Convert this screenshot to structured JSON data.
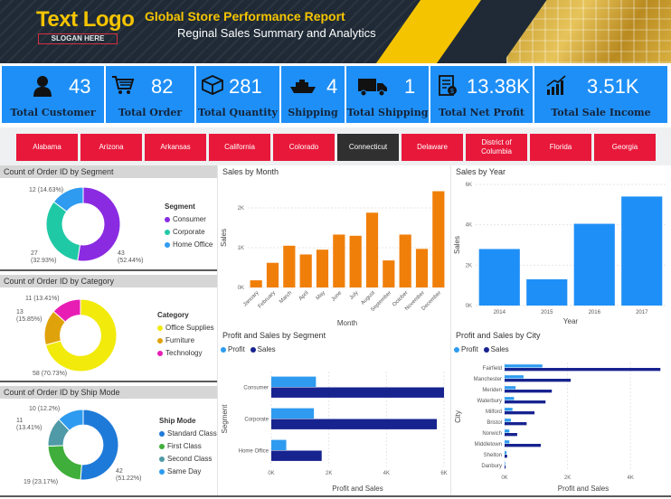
{
  "header": {
    "logo_text": "Text Logo",
    "logo_slogan": "SLOGAN HERE",
    "title": "Global Store Performance Report",
    "subtitle": "Reginal Sales Summary and Analytics"
  },
  "kpis": [
    {
      "value": "43",
      "label": "Total Customer",
      "icon": "person-icon"
    },
    {
      "value": "82",
      "label": "Total Order",
      "icon": "cart-icon"
    },
    {
      "value": "281",
      "label": "Total Quantity",
      "icon": "box-icon"
    },
    {
      "value": "4",
      "label": "Shipping",
      "icon": "ship-icon"
    },
    {
      "value": "1",
      "label": "Total Shipping",
      "icon": "truck-icon"
    },
    {
      "value": "13.38K",
      "label": "Total Net Profit",
      "icon": "invoice-icon"
    },
    {
      "value": "3.51K",
      "label": "Total Sale Income",
      "icon": "growth-chart-icon"
    }
  ],
  "states": [
    {
      "label": "Alabama",
      "active": false
    },
    {
      "label": "Arizona",
      "active": false
    },
    {
      "label": "Arkansas",
      "active": false
    },
    {
      "label": "California",
      "active": false
    },
    {
      "label": "Colorado",
      "active": false
    },
    {
      "label": "Connecticut",
      "active": true
    },
    {
      "label": "Delaware",
      "active": false
    },
    {
      "label": "District of Columbia",
      "active": false
    },
    {
      "label": "Florida",
      "active": false
    },
    {
      "label": "Georgia",
      "active": false
    }
  ],
  "colors": {
    "kpi_blue": "#1e8ff7",
    "state_red": "#e8183a",
    "state_active": "#303030",
    "orange": "#f07f0a",
    "bar_blue": "#1e8ff7",
    "profit": "#2e9bf0",
    "sales": "#17238f"
  },
  "panels": {
    "segment": {
      "title": "Count of Order ID by Segment",
      "legend_title": "Segment",
      "labels": [
        {
          "text": "12 (14.63%)"
        },
        {
          "text": "27 (32.93%)"
        },
        {
          "text": "43 (52.44%)"
        }
      ]
    },
    "category": {
      "title": "Count of Order ID by Category",
      "legend_title": "Category",
      "labels": [
        {
          "text": "11 (13.41%)"
        },
        {
          "text": "13 (15.85%)"
        },
        {
          "text": "58 (70.73%)"
        }
      ]
    },
    "shipmode": {
      "title": "Count of Order ID by Ship Mode",
      "legend_title": "Ship Mode",
      "labels": [
        {
          "text": "10 (12.2%)"
        },
        {
          "text": "11 (13.41%)"
        },
        {
          "text": "19 (23.17%)"
        },
        {
          "text": "42 (51.22%)"
        }
      ]
    },
    "month": {
      "title": "Sales by Month"
    },
    "year": {
      "title": "Sales by Year"
    },
    "profit_segment": {
      "title": "Profit and Sales by Segment"
    },
    "profit_city": {
      "title": "Profit and Sales by City"
    }
  },
  "chart_data": [
    {
      "type": "pie",
      "title": "Count of Order ID by Segment",
      "categories": [
        "Consumer",
        "Corporate",
        "Home Office"
      ],
      "values": [
        43,
        27,
        12
      ],
      "colors": [
        "#8a2be2",
        "#20c9a6",
        "#2e9bf0"
      ],
      "legend": "right"
    },
    {
      "type": "pie",
      "title": "Count of Order ID by Category",
      "categories": [
        "Office Supplies",
        "Furniture",
        "Technology"
      ],
      "values": [
        58,
        13,
        11
      ],
      "colors": [
        "#f2ea0a",
        "#e0a20a",
        "#e81eb4"
      ],
      "legend": "right"
    },
    {
      "type": "pie",
      "title": "Count of Order ID by Ship Mode",
      "categories": [
        "Standard Class",
        "First Class",
        "Second Class",
        "Same Day"
      ],
      "values": [
        42,
        19,
        11,
        10
      ],
      "colors": [
        "#1e7ad8",
        "#3fae3a",
        "#4f9aa6",
        "#2e9bf0"
      ],
      "legend": "right"
    },
    {
      "type": "bar",
      "title": "Sales by Month",
      "xlabel": "Month",
      "ylabel": "Sales",
      "categories": [
        "January",
        "February",
        "March",
        "April",
        "May",
        "June",
        "July",
        "August",
        "September",
        "October",
        "November",
        "December"
      ],
      "values": [
        180,
        620,
        1050,
        830,
        950,
        1330,
        1300,
        1880,
        680,
        1330,
        970,
        2420
      ],
      "ylim": [
        0,
        2500
      ],
      "yticks": [
        "0K",
        "1K",
        "2K"
      ],
      "ytick_values": [
        0,
        1000,
        2000
      ],
      "color": "#f07f0a",
      "grid": true
    },
    {
      "type": "bar",
      "title": "Sales by Year",
      "xlabel": "Year",
      "ylabel": "Sales",
      "categories": [
        "2014",
        "2015",
        "2016",
        "2017"
      ],
      "values": [
        2800,
        1300,
        4050,
        5400
      ],
      "ylim": [
        0,
        6000
      ],
      "yticks": [
        "0K",
        "2K",
        "4K",
        "6K"
      ],
      "ytick_values": [
        0,
        2000,
        4000,
        6000
      ],
      "color": "#1e8ff7",
      "grid": true
    },
    {
      "type": "bar",
      "orientation": "horizontal",
      "title": "Profit and Sales by Segment",
      "xlabel": "Profit and Sales",
      "ylabel": "Segment",
      "categories": [
        "Consumer",
        "Corporate",
        "Home Office"
      ],
      "series": [
        {
          "name": "Profit",
          "values": [
            1550,
            1480,
            520
          ],
          "color": "#2e9bf0"
        },
        {
          "name": "Sales",
          "values": [
            6000,
            5750,
            1750
          ],
          "color": "#17238f"
        }
      ],
      "xlim": [
        0,
        6000
      ],
      "xticks": [
        "0K",
        "2K",
        "4K",
        "6K"
      ],
      "xtick_values": [
        0,
        2000,
        4000,
        6000
      ],
      "legend": "top-left"
    },
    {
      "type": "bar",
      "orientation": "horizontal",
      "title": "Profit and Sales by City",
      "xlabel": "Profit and Sales",
      "ylabel": "City",
      "categories": [
        "Fairfield",
        "Manchester",
        "Meriden",
        "Waterbury",
        "Milford",
        "Bristol",
        "Norwich",
        "Middletown",
        "Shelton",
        "Danbury"
      ],
      "series": [
        {
          "name": "Profit",
          "values": [
            1200,
            600,
            350,
            300,
            250,
            200,
            150,
            150,
            60,
            20
          ],
          "color": "#2e9bf0"
        },
        {
          "name": "Sales",
          "values": [
            4950,
            2100,
            1500,
            1300,
            950,
            700,
            400,
            1150,
            80,
            30
          ],
          "color": "#17238f"
        }
      ],
      "xlim": [
        0,
        5000
      ],
      "xticks": [
        "0K",
        "2K",
        "4K"
      ],
      "xtick_values": [
        0,
        2000,
        4000
      ],
      "legend": "top-left"
    }
  ]
}
